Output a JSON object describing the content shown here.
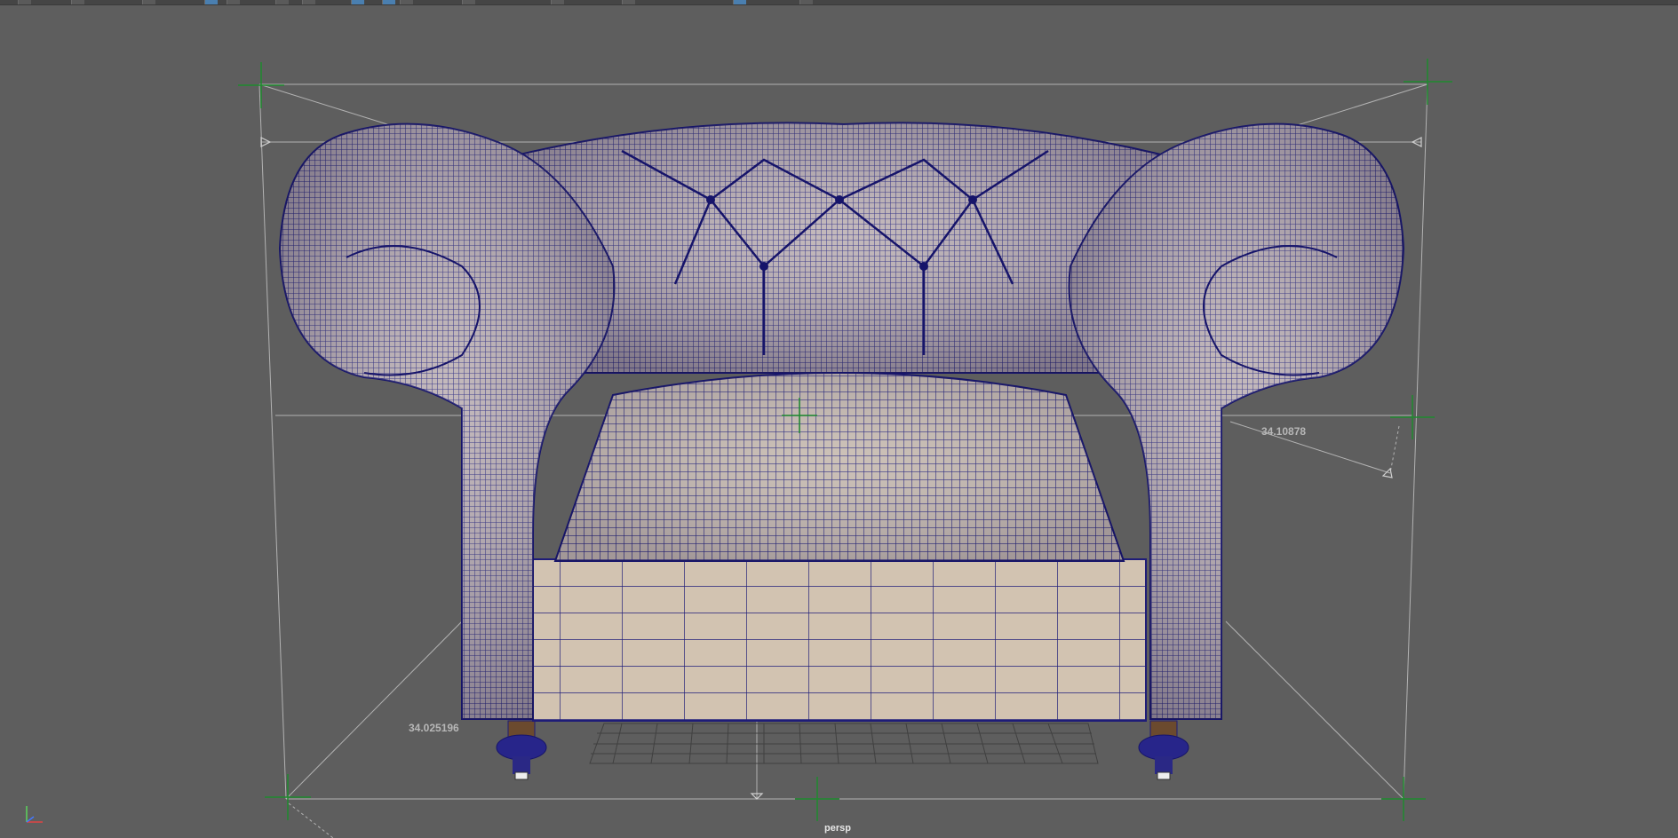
{
  "app": {
    "name": "Maya viewport"
  },
  "viewport": {
    "camera": "persp",
    "dimensions": {
      "depth": "34.10878",
      "width_front": "34.025196"
    }
  },
  "colors": {
    "background": "#5e5e5e",
    "wireframe": "#1c1a7a",
    "fabric": "#c9bcb0",
    "guide_lines": "#c8c8c8",
    "locator": "#1f8a2e",
    "legs": "#6b4a2e"
  },
  "icons": [
    "toolbar-button-icon",
    "axis-gizmo-icon",
    "locator-icon",
    "annotation-arrow-icon"
  ]
}
